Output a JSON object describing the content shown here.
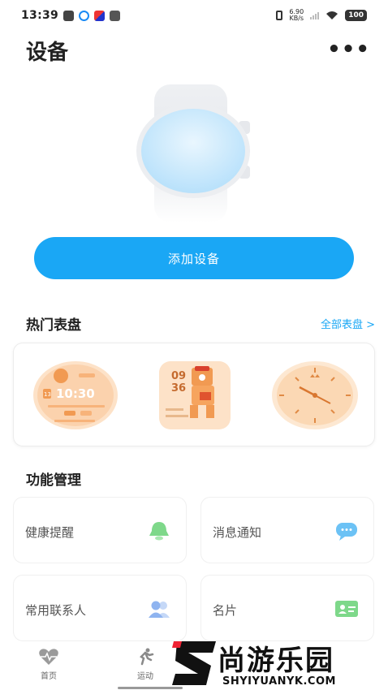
{
  "status_bar": {
    "time": "13:39",
    "network_speed": "6.90",
    "network_unit": "KB/s",
    "battery": "100"
  },
  "header": {
    "title": "设备",
    "more": "•••"
  },
  "add_device": {
    "label": "添加设备"
  },
  "watch_faces": {
    "title": "热门表盘",
    "all_link": "全部表盘 >",
    "face1": {
      "time": "10:30",
      "date": "13"
    },
    "face2": {
      "hour": "09",
      "minute": "36"
    }
  },
  "functions": {
    "title": "功能管理",
    "items": [
      {
        "label": "健康提醒",
        "icon": "bell-icon",
        "color": "#7ed88a"
      },
      {
        "label": "消息通知",
        "icon": "chat-bubble-icon",
        "color": "#6cc2f5"
      },
      {
        "label": "常用联系人",
        "icon": "contacts-icon",
        "color": "#8fb4f0"
      },
      {
        "label": "名片",
        "icon": "id-card-icon",
        "color": "#7ed88a"
      }
    ]
  },
  "bottom_nav": {
    "items": [
      {
        "label": "首页",
        "icon": "heart-pulse-icon"
      },
      {
        "label": "运动",
        "icon": "running-icon"
      }
    ]
  },
  "watermark": {
    "brand_cn": "尚游乐园",
    "brand_en": "SHYIYUANYK.COM"
  },
  "colors": {
    "accent": "#1aa7f5",
    "face_orange": "#f6a45e"
  }
}
